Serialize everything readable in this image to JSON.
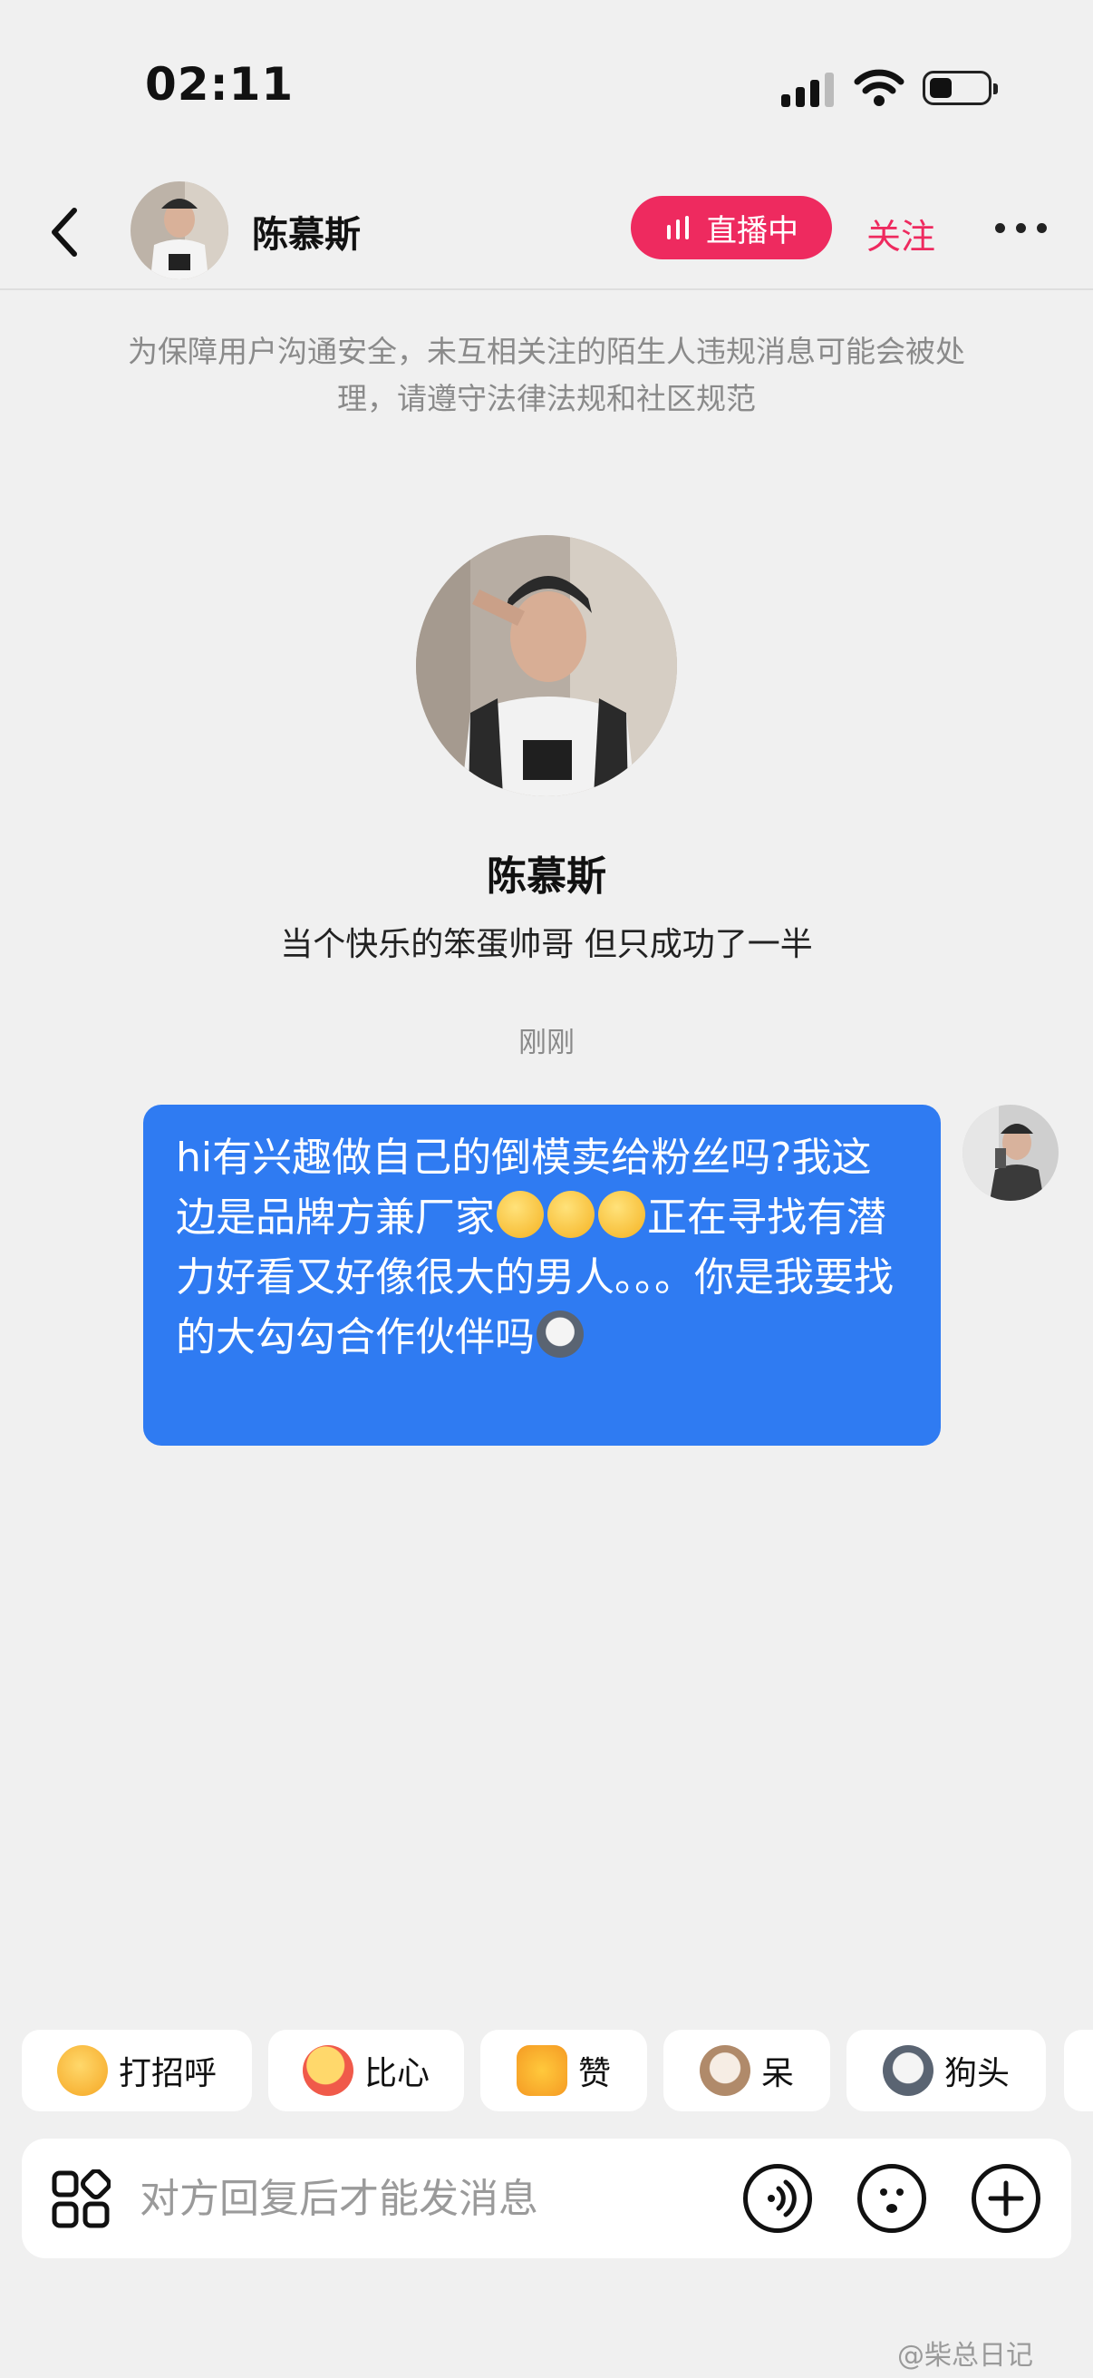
{
  "status_bar": {
    "time": "02:11"
  },
  "header": {
    "name": "陈慕斯",
    "live_label": "直播中",
    "follow_label": "关注"
  },
  "notice": "为保障用户沟通安全，未互相关注的陌生人违规消息可能会被处理，请遵守法律法规和社区规范",
  "profile": {
    "name": "陈慕斯",
    "bio": "当个快乐的笨蛋帅哥 但只成功了一半"
  },
  "timestamp": "刚刚",
  "message": {
    "part1": "hi有兴趣做自己的倒模卖给粉丝吗?我这边是品牌方兼厂家",
    "part2": "正在寻找有潜力好看又好像很大的男人。。。你是我要找的大勾勾合作伙伴吗"
  },
  "quick_replies": [
    {
      "label": "打招呼",
      "icon": "wave-emoji-icon"
    },
    {
      "label": "比心",
      "icon": "heart-hands-emoji-icon"
    },
    {
      "label": "赞",
      "icon": "thumbs-up-icon"
    },
    {
      "label": "呆",
      "icon": "cat-face-icon"
    },
    {
      "label": "狗头",
      "icon": "dog-head-icon"
    }
  ],
  "input": {
    "placeholder": "对方回复后才能发消息"
  },
  "watermark": "@柴总日记",
  "colors": {
    "accent_pink": "#ee2a5f",
    "bubble_blue": "#2f7bf2",
    "background": "#f0f0f0"
  }
}
